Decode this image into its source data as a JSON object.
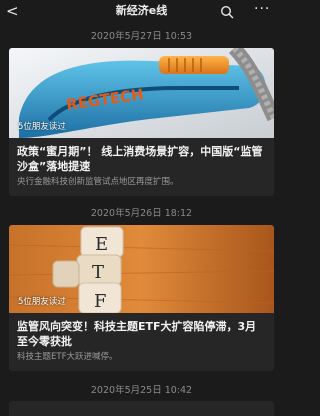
{
  "header": {
    "back_icon": "chevron-left-icon",
    "title": "新经济e线",
    "search_icon": "search-icon",
    "more_icon": "more-dots-icon",
    "back_glyph": "<",
    "more_glyph": "···"
  },
  "feed": [
    {
      "date": "2020年5月27日 10:53",
      "read_count": "5位朋友读过",
      "image_text": "REGTECH",
      "title": "政策“蜜月期”！ 线上消费场景扩容，中国版“监管沙盒”落地提速",
      "summary": "央行金融科技创新监管试点地区再度扩围。"
    },
    {
      "date": "2020年5月26日 18:12",
      "read_count": "5位朋友读过",
      "image_text": "ETF",
      "title": "监管风向突变！科技主题ETF大扩容陷停滞，3月至今零获批",
      "summary": "科技主题ETF大跃进喊停。"
    },
    {
      "date": "2020年5月25日 10:42"
    }
  ]
}
